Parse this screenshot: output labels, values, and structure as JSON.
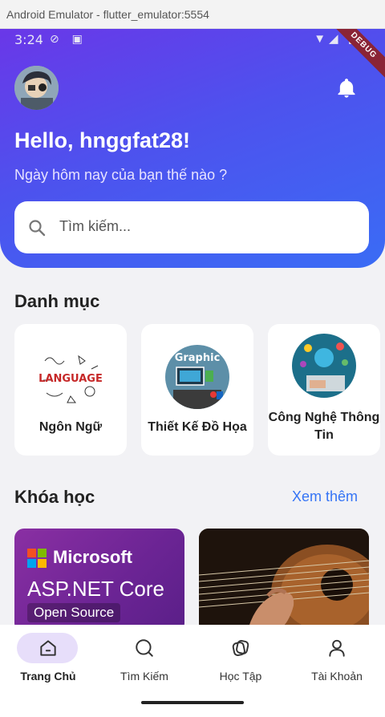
{
  "window": {
    "title": "Android Emulator - flutter_emulator:5554"
  },
  "status_bar": {
    "time": "3:24",
    "debug": "DEBUG"
  },
  "header": {
    "greeting": "Hello, hnggfat28!",
    "subtitle": "Ngày hôm nay của bạn thế nào ?",
    "search_placeholder": "Tìm kiếm..."
  },
  "categories": {
    "title": "Danh mục",
    "items": [
      {
        "label": "Ngôn Ngữ"
      },
      {
        "label": "Thiết Kế Đồ Họa"
      },
      {
        "label": "Công Nghệ Thông Tin"
      }
    ]
  },
  "courses": {
    "title": "Khóa học",
    "see_more": "Xem thêm",
    "items": [
      {
        "brand": "Microsoft",
        "title": "ASP.NET Core",
        "subtitle": "Open Source"
      },
      {
        "image": "guitar-photo"
      }
    ]
  },
  "category_art": {
    "language": "LANGUAGE",
    "graphic": "Graphic"
  },
  "nav": {
    "items": [
      {
        "label": "Trang Chủ",
        "icon": "home-icon",
        "active": true
      },
      {
        "label": "Tìm Kiếm",
        "icon": "search-icon",
        "active": false
      },
      {
        "label": "Học Tập",
        "icon": "learning-icon",
        "active": false
      },
      {
        "label": "Tài Khoản",
        "icon": "account-icon",
        "active": false
      }
    ]
  },
  "colors": {
    "accent": "#3574f5",
    "hero_start": "#6a37e8",
    "hero_end": "#3a6cf5",
    "nav_active_pill": "#e7defa"
  }
}
